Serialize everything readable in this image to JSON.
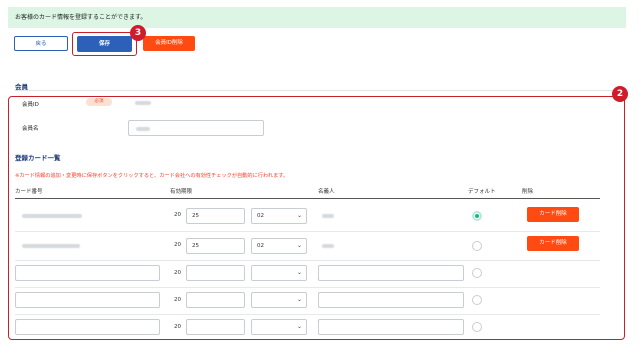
{
  "notice": "お客様のカード情報を登録することができます。",
  "buttons": {
    "back": "戻る",
    "save": "保存",
    "delete_member": "会員ID削除"
  },
  "callouts": {
    "save_marker": "3",
    "cards_marker": "2"
  },
  "member": {
    "section_title": "会員",
    "id_label": "会員ID",
    "required_badge": "必須",
    "name_label": "会員名"
  },
  "cards": {
    "section_title": "登録カード一覧",
    "warning": "※カード情報の追加・変更時に保存ボタンをクリックすると、カード会社への有効性チェックが自動的に行われます。",
    "headers": {
      "number": "カード番号",
      "expiry": "有効期限",
      "holder": "名義人",
      "default": "デフォルト",
      "delete": "削除"
    },
    "year_prefix": "20",
    "rows": [
      {
        "year": "25",
        "month": "02",
        "default": true,
        "delete_label": "カード削除"
      },
      {
        "year": "25",
        "month": "02",
        "default": false,
        "delete_label": "カード削除"
      },
      {
        "year": "",
        "month": "",
        "default": false,
        "delete_label": ""
      },
      {
        "year": "",
        "month": "",
        "default": false,
        "delete_label": ""
      },
      {
        "year": "",
        "month": "",
        "default": false,
        "delete_label": ""
      }
    ]
  },
  "colors": {
    "accent_blue": "#2d60b8",
    "danger_orange": "#ff4a12",
    "notice_green": "#dcf5e5",
    "callout_red": "#cf1b2a",
    "radio_green": "#12b98a"
  }
}
